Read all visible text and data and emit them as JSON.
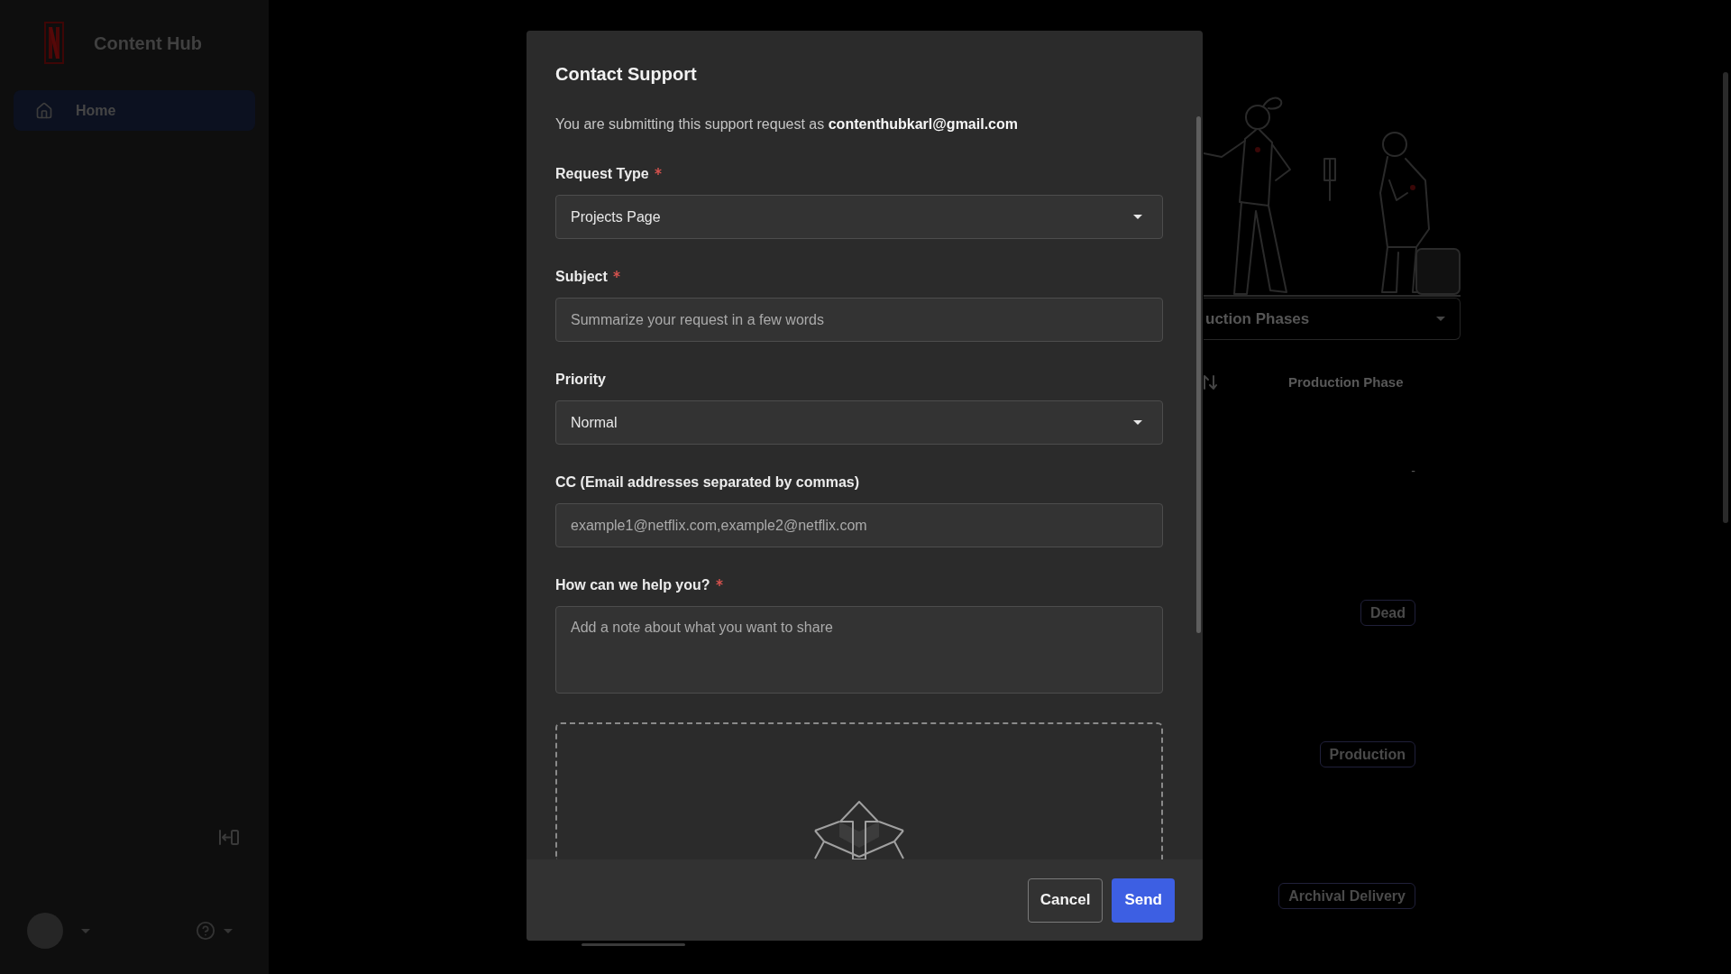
{
  "sidebar": {
    "logo_text": "Content Hub",
    "nav_items": [
      {
        "label": "Home",
        "selected": true
      }
    ]
  },
  "background": {
    "filter_select": {
      "value": "uction Phases"
    },
    "table": {
      "columns": [
        "Production Phase"
      ],
      "rows": [
        {
          "kind": "text",
          "production_phase": "-"
        },
        {
          "kind": "tag",
          "production_phase": "Dead"
        },
        {
          "kind": "tag",
          "production_phase": "Production"
        },
        {
          "kind": "tag",
          "production_phase": "Archival Delivery"
        }
      ]
    }
  },
  "modal": {
    "title": "Contact Support",
    "intro": "You are submitting this support request as **contenthubkarl@gmail.com**",
    "fields": [
      {
        "kind": "select",
        "label": "Request Type",
        "required": true,
        "value": "Projects Page"
      },
      {
        "kind": "text",
        "label": "Subject",
        "required": true,
        "placeholder": "Summarize your request in a few words"
      },
      {
        "kind": "select",
        "label": "Priority",
        "required": false,
        "value": "Normal"
      },
      {
        "kind": "text",
        "label": "CC (Email addresses separated by commas)",
        "required": false,
        "placeholder": "example1@netflix.com,example2@netflix.com"
      },
      {
        "kind": "textarea",
        "label": "How can we help you?",
        "required": true,
        "placeholder": "Add a note about what you want to share"
      }
    ],
    "buttons": [
      {
        "kind": "secondary",
        "label": "Cancel"
      },
      {
        "kind": "primary",
        "label": "Send"
      }
    ]
  }
}
